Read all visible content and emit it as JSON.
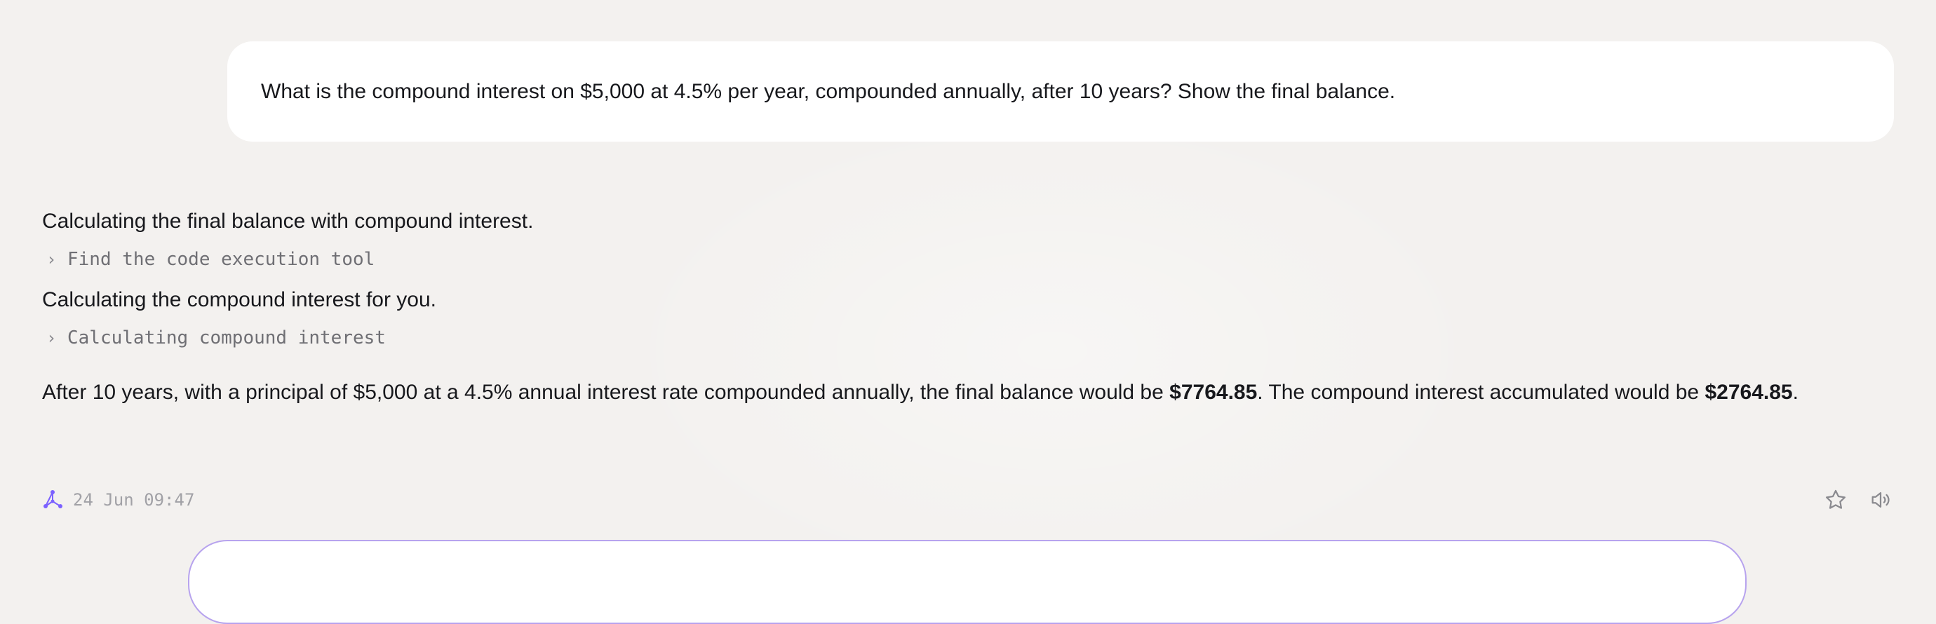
{
  "user_message": {
    "text": "What is the compound interest on $5,000 at 4.5% per year, compounded annually, after 10 years? Show the final balance."
  },
  "assistant": {
    "steps": [
      {
        "text": "Calculating the final balance with compound interest.",
        "tool_label": "Find the code execution tool"
      },
      {
        "text": "Calculating the compound interest for you.",
        "tool_label": "Calculating compound interest"
      }
    ],
    "answer": {
      "part1": "After 10 years, with a principal of $5,000 at a 4.5% annual interest rate compounded annually, the final balance would be ",
      "bold1": "$7764.85",
      "part2": ". The compound interest accumulated would be ",
      "bold2": "$2764.85",
      "part3": "."
    },
    "timestamp": "24 Jun 09:47"
  },
  "icons": {
    "brand": "assistant-logo-icon",
    "chevron": "chevron-right-icon",
    "favorite": "star-icon",
    "read_aloud": "speaker-icon"
  },
  "colors": {
    "background": "#f3f1ef",
    "bubble": "#ffffff",
    "accent": "#7b61ff",
    "input_border": "#b7a3ee",
    "muted_text": "#a1a1a6"
  }
}
